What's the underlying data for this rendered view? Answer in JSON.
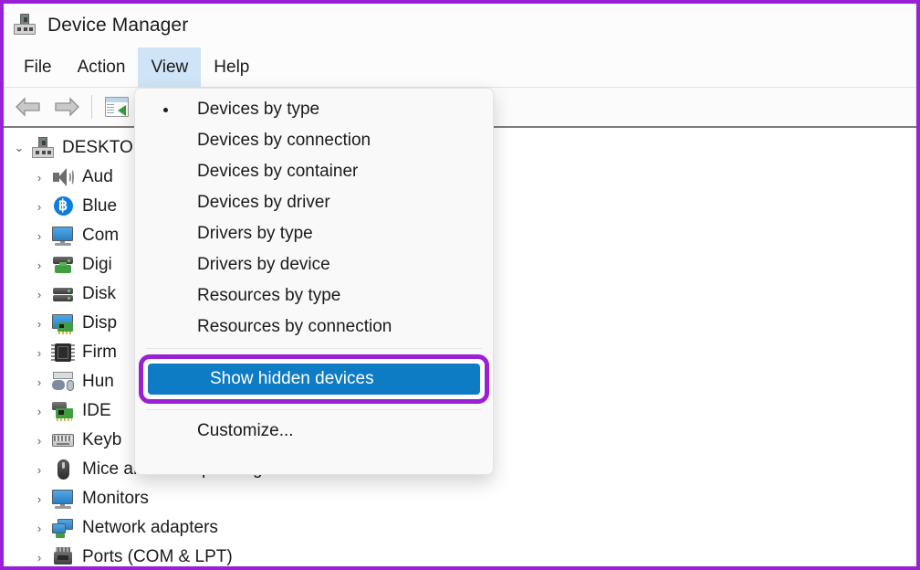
{
  "window": {
    "title": "Device Manager",
    "title_icon": "device-manager-icon"
  },
  "menubar": {
    "items": [
      {
        "label": "File",
        "active": false
      },
      {
        "label": "Action",
        "active": false
      },
      {
        "label": "View",
        "active": true
      },
      {
        "label": "Help",
        "active": false
      }
    ]
  },
  "toolbar": {
    "buttons": [
      {
        "name": "back-button",
        "icon": "arrow-left-icon"
      },
      {
        "name": "forward-button",
        "icon": "arrow-right-icon"
      },
      {
        "name": "show-console-tree-button",
        "icon": "console-tree-icon"
      }
    ]
  },
  "view_menu": {
    "items": [
      {
        "label": "Devices by type",
        "checked": true,
        "selected": false
      },
      {
        "label": "Devices by connection",
        "checked": false,
        "selected": false
      },
      {
        "label": "Devices by container",
        "checked": false,
        "selected": false
      },
      {
        "label": "Devices by driver",
        "checked": false,
        "selected": false
      },
      {
        "label": "Drivers by type",
        "checked": false,
        "selected": false
      },
      {
        "label": "Drivers by device",
        "checked": false,
        "selected": false
      },
      {
        "label": "Resources by type",
        "checked": false,
        "selected": false
      },
      {
        "label": "Resources by connection",
        "checked": false,
        "selected": false
      }
    ],
    "highlighted_item": {
      "label": "Show hidden devices",
      "selected": true
    },
    "last_item": {
      "label": "Customize..."
    }
  },
  "tree": {
    "root": {
      "label": "DESKTO",
      "icon": "computer-icon",
      "expanded": true
    },
    "nodes": [
      {
        "label": "Aud",
        "icon": "speaker-icon"
      },
      {
        "label": "Blue",
        "icon": "bluetooth-icon"
      },
      {
        "label": "Com",
        "icon": "monitor-icon"
      },
      {
        "label": "Digi",
        "icon": "digital-media-icon"
      },
      {
        "label": "Disk",
        "icon": "disk-drive-icon"
      },
      {
        "label": "Disp",
        "icon": "display-adapter-icon"
      },
      {
        "label": "Firm",
        "icon": "firmware-chip-icon"
      },
      {
        "label": "Hun",
        "icon": "human-interface-device-icon"
      },
      {
        "label": "IDE ",
        "icon": "ide-controller-icon"
      },
      {
        "label": "Keyb",
        "icon": "keyboard-icon"
      },
      {
        "label": "Mice and other pointing devices",
        "icon": "mouse-icon"
      },
      {
        "label": "Monitors",
        "icon": "monitor-icon"
      },
      {
        "label": "Network adapters",
        "icon": "network-adapter-icon"
      },
      {
        "label": "Ports (COM & LPT)",
        "icon": "port-icon"
      }
    ]
  },
  "annotation": {
    "frame_color": "#9b1fd4",
    "highlight_color": "#0e7cc4"
  }
}
